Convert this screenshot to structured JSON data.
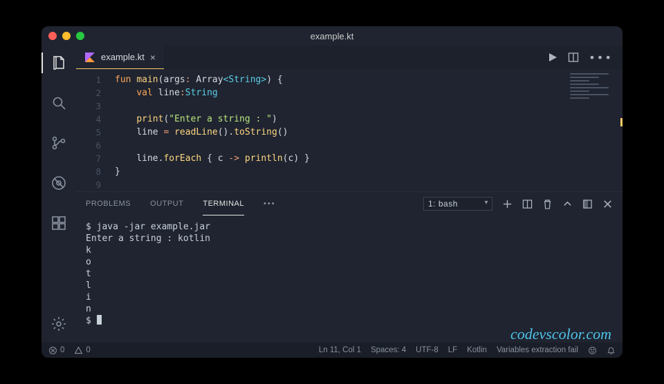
{
  "window": {
    "title": "example.kt"
  },
  "tab": {
    "filename": "example.kt",
    "close": "×"
  },
  "editor": {
    "line_numbers": [
      "1",
      "2",
      "3",
      "4",
      "5",
      "6",
      "7",
      "8",
      "9"
    ],
    "lines": {
      "l1": {
        "kw_fun": "fun",
        "fn": "main",
        "lp": "(",
        "arg": "args",
        "col": ":",
        "sp": " ",
        "arr": "Array",
        "lt": "<",
        "str_t": "String",
        "gt": ">",
        "rp": ")",
        "ob": " {"
      },
      "l2": {
        "kw_val": "val",
        "id": "line",
        "col": ":",
        "type": "String"
      },
      "l4": {
        "fn": "print",
        "lp": "(",
        "str": "\"Enter a string : \"",
        "rp": ")"
      },
      "l5": {
        "lhs": "line",
        "eq": " = ",
        "fn1": "readLine",
        "p1": "().",
        "fn2": "toString",
        "p2": "()"
      },
      "l7": {
        "obj": "line",
        "dot": ".",
        "fn": "forEach",
        "sp": " ",
        "ob": "{",
        "arg": " c ",
        "arrow": "->",
        "sp2": " ",
        "fn2": "println",
        "lp": "(",
        "a2": "c",
        "rp": ")",
        "cb": " }"
      },
      "l8": {
        "cb": "}"
      }
    }
  },
  "panel": {
    "tabs": {
      "problems": "PROBLEMS",
      "output": "OUTPUT",
      "terminal": "TERMINAL"
    },
    "terminal_select": "1: bash"
  },
  "terminal": {
    "lines": [
      "$ java -jar example.jar",
      "Enter a string : kotlin",
      "k",
      "o",
      "t",
      "l",
      "i",
      "n",
      "$ "
    ]
  },
  "status": {
    "errors": "0",
    "warnings": "0",
    "cursor": "Ln 11, Col 1",
    "spaces": "Spaces: 4",
    "encoding": "UTF-8",
    "eol": "LF",
    "lang": "Kotlin",
    "msg": "Variables extraction fail"
  },
  "watermark": "codevscolor.com"
}
